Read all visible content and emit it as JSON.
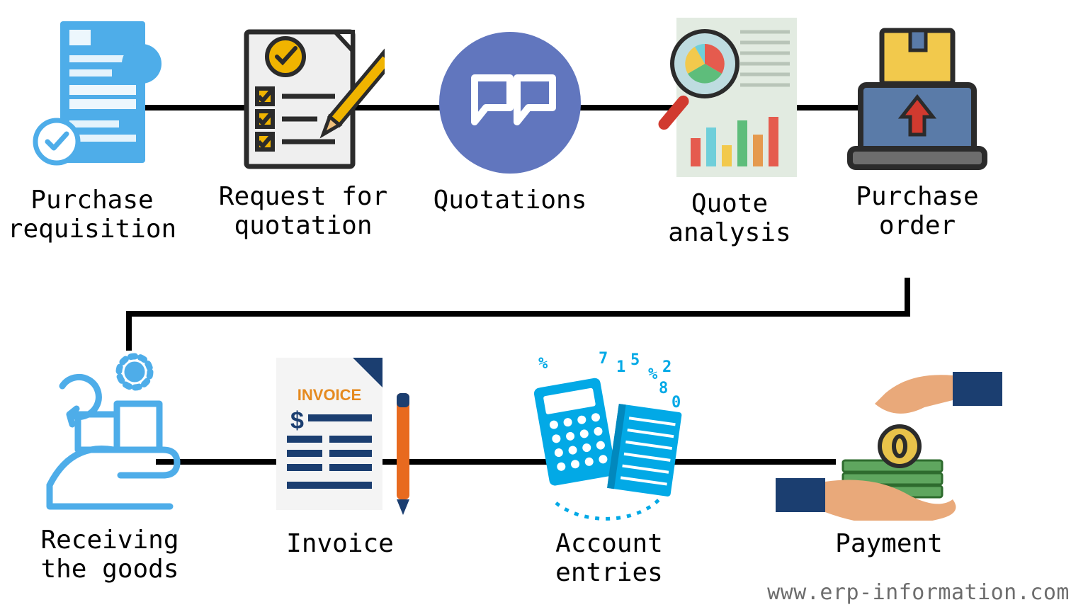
{
  "steps": {
    "purchase_requisition": "Purchase\nrequisition",
    "request_for_quotation": "Request for\nquotation",
    "quotations": "Quotations",
    "quote_analysis": "Quote\nanalysis",
    "purchase_order": "Purchase\norder",
    "receiving_the_goods": "Receiving\nthe goods",
    "invoice": "Invoice",
    "account_entries": "Account\nentries",
    "payment": "Payment"
  },
  "invoice_badge": "INVOICE",
  "footer": "www.erp-information.com",
  "flow_order": [
    "purchase_requisition",
    "request_for_quotation",
    "quotations",
    "quote_analysis",
    "purchase_order",
    "receiving_the_goods",
    "invoice",
    "account_entries",
    "payment"
  ],
  "colors": {
    "blue_light": "#4EADE9",
    "blue_medium": "#6176BE",
    "blue_dark": "#1B3E70",
    "orange": "#F19B06",
    "red": "#E74C3C",
    "green": "#4CAF50",
    "cyan": "#02A9E6",
    "gray_bg": "#E2EBE1"
  }
}
